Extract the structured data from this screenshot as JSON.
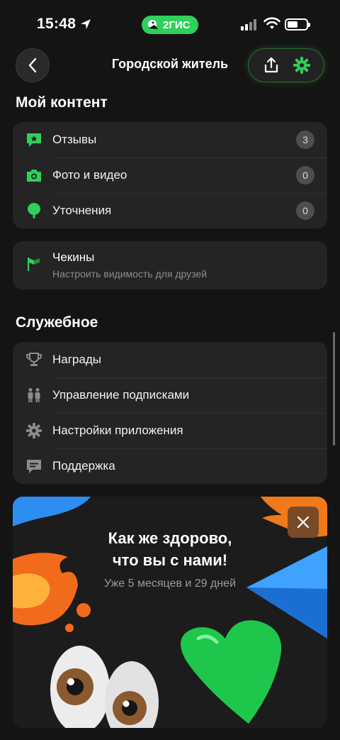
{
  "status_bar": {
    "time": "15:48",
    "brand": "2ГИС"
  },
  "header": {
    "title": "Городской житель"
  },
  "my_content": {
    "title": "Мой контент",
    "items": [
      {
        "label": "Отзывы",
        "count": "3",
        "icon": "review-star-icon"
      },
      {
        "label": "Фото и видео",
        "count": "0",
        "icon": "camera-icon"
      },
      {
        "label": "Уточнения",
        "count": "0",
        "icon": "pin-icon"
      }
    ],
    "checkins": {
      "label": "Чекины",
      "sub": "Настроить видимость для друзей",
      "icon": "flag-icon"
    }
  },
  "service": {
    "title": "Служебное",
    "items": [
      {
        "label": "Награды",
        "icon": "trophy-icon"
      },
      {
        "label": "Управление подписками",
        "icon": "people-icon"
      },
      {
        "label": "Настройки приложения",
        "icon": "gear-icon"
      },
      {
        "label": "Поддержка",
        "icon": "chat-icon"
      }
    ]
  },
  "promo": {
    "line1": "Как же здорово,",
    "line2": "что вы с нами!",
    "sub": "Уже 5 месяцев и 29 дней"
  },
  "colors": {
    "accent": "#2fd05b",
    "card": "#242424",
    "background": "#141414"
  }
}
